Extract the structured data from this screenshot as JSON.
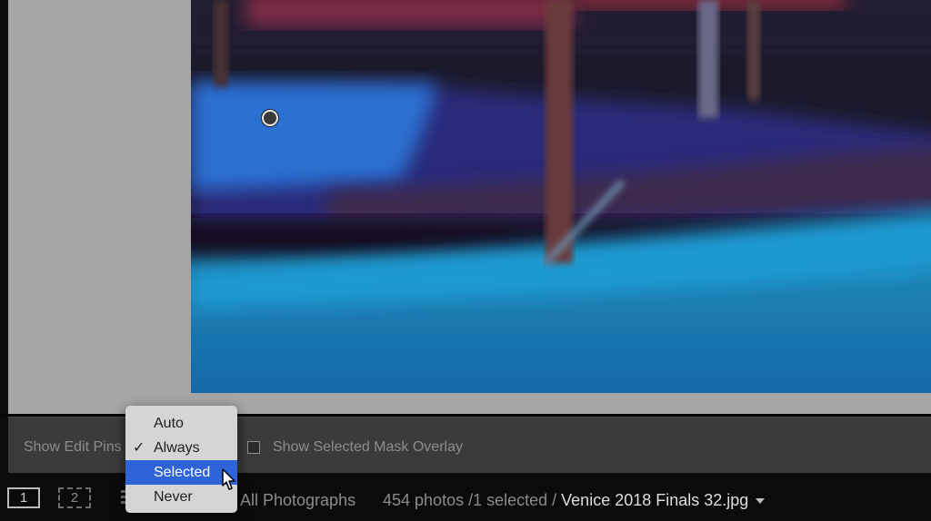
{
  "photo": {
    "description_icon": "photo-canvas"
  },
  "toolbar": {
    "show_edit_pins_label": "Show Edit Pins",
    "mask_overlay_label": "Show Selected Mask Overlay",
    "mask_overlay_checked": false
  },
  "dropdown": {
    "items": [
      {
        "label": "Auto",
        "checked": false,
        "highlighted": false
      },
      {
        "label": "Always",
        "checked": true,
        "highlighted": false
      },
      {
        "label": "Selected",
        "checked": false,
        "highlighted": true
      },
      {
        "label": "Never",
        "checked": false,
        "highlighted": false
      }
    ],
    "check_glyph": "✓"
  },
  "filmstrip": {
    "view1_label": "1",
    "view2_label": "2",
    "source_label": "All Photographs",
    "status_prefix": "454 photos /1 selected /",
    "filename": "Venice 2018 Finals 32.jpg"
  },
  "colors": {
    "menu_highlight": "#2f63d8",
    "panel_bg": "#3b3b3b",
    "canvas_bg": "#a6a6a6"
  }
}
